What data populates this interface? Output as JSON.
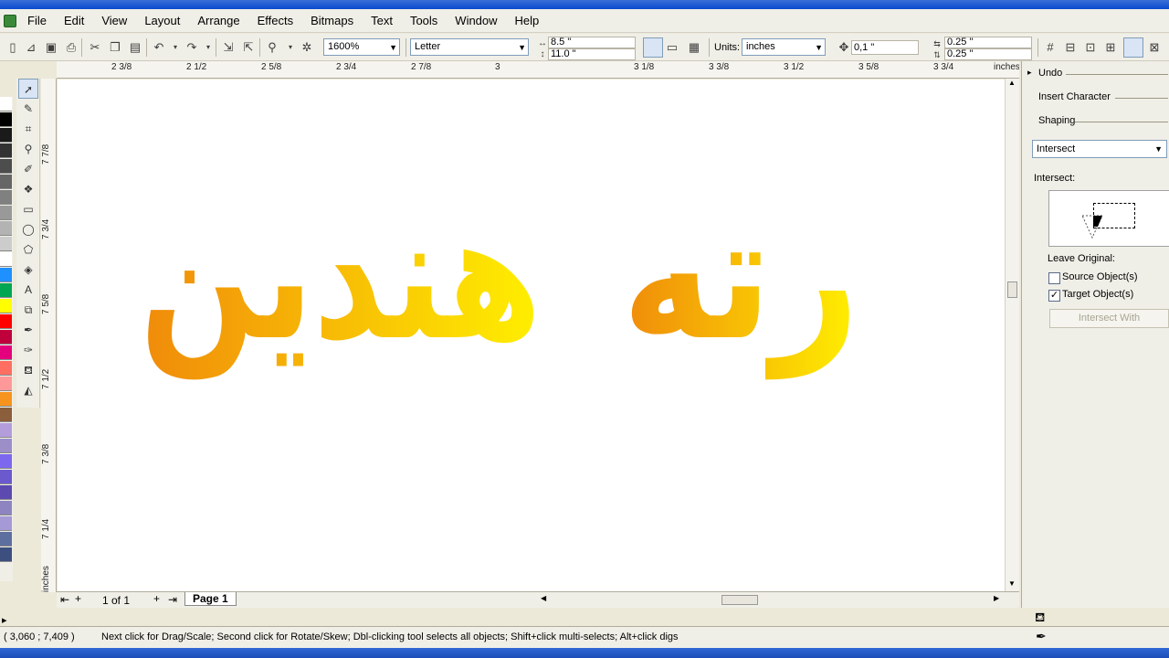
{
  "menu": [
    "File",
    "Edit",
    "View",
    "Layout",
    "Arrange",
    "Effects",
    "Bitmaps",
    "Text",
    "Tools",
    "Window",
    "Help"
  ],
  "toolbar": {
    "zoom": "1600%",
    "paper_type": "Letter",
    "width": "8.5 \"",
    "height": "11.0 \"",
    "units_label": "Units:",
    "units": "inches",
    "nudge": "0,1 \"",
    "dup_x": "0.25 \"",
    "dup_y": "0.25 \""
  },
  "ruler_top": [
    "2 3/8",
    "2 1/2",
    "2 5/8",
    "2 3/4",
    "2 7/8",
    "3",
    "3 1/8",
    "3 3/8",
    "3 1/2",
    "3 5/8",
    "3 3/4",
    "inches"
  ],
  "ruler_left": [
    "7 7/8",
    "7 3/4",
    "7 5/8",
    "7 1/2",
    "7 3/8",
    "7 1/4",
    "inches"
  ],
  "canvas": {
    "word_left": "هندين",
    "word_right": "رته",
    "gradient_start": "#f08a0a",
    "gradient_end": "#fff000"
  },
  "docker": {
    "tab_undo": "Undo",
    "tab_insert_character": "Insert Character",
    "tab_shaping": "Shaping",
    "operation": "Intersect",
    "section_label": "Intersect:",
    "leave_original": "Leave Original:",
    "source_objects": "Source Object(s)",
    "source_checked": false,
    "target_objects": "Target Object(s)",
    "target_checked": true,
    "apply_button": "Intersect With"
  },
  "page_tabs": {
    "counter": "1 of 1",
    "page_label": "Page 1"
  },
  "status": {
    "coords": "( 3,060 ; 7,409 )",
    "hint": "Next click for Drag/Scale; Second click for Rotate/Skew; Dbl-clicking tool selects all objects; Shift+click multi-selects; Alt+click digs"
  },
  "palette_colors": [
    "#ffffff",
    "#000000",
    "#1a1a1a",
    "#333333",
    "#4d4d4d",
    "#666666",
    "#808080",
    "#999999",
    "#b3b3b3",
    "#cccccc",
    "#ffffff",
    "#1e90ff",
    "#00a651",
    "#ffff00",
    "#ff0000",
    "#c0003c",
    "#e4007c",
    "#ff6f61",
    "#ff9999",
    "#f7941d",
    "#8b5e3c",
    "#b39ddb",
    "#9c8ec7",
    "#7b68ee",
    "#6a5acd",
    "#5c4ab0",
    "#8e84c0",
    "#a599d6",
    "#5d6f9e",
    "#3c4f7f"
  ],
  "icons": {
    "select": "arrow-pointer-icon",
    "shape": "shape-tool-icon",
    "crop": "crop-icon",
    "zoom": "magnifier-icon",
    "freehand": "freehand-icon",
    "smartfill": "smart-fill-icon",
    "rectangle": "rectangle-icon",
    "ellipse": "ellipse-icon",
    "polygon": "polygon-icon",
    "basic_shapes": "basic-shapes-icon",
    "text": "text-icon",
    "interactive": "interactive-blend-icon",
    "eyedropper": "eyedropper-icon",
    "outline": "pen-nib-icon",
    "fill": "bucket-icon",
    "interactive_fill": "interactive-fill-icon"
  }
}
